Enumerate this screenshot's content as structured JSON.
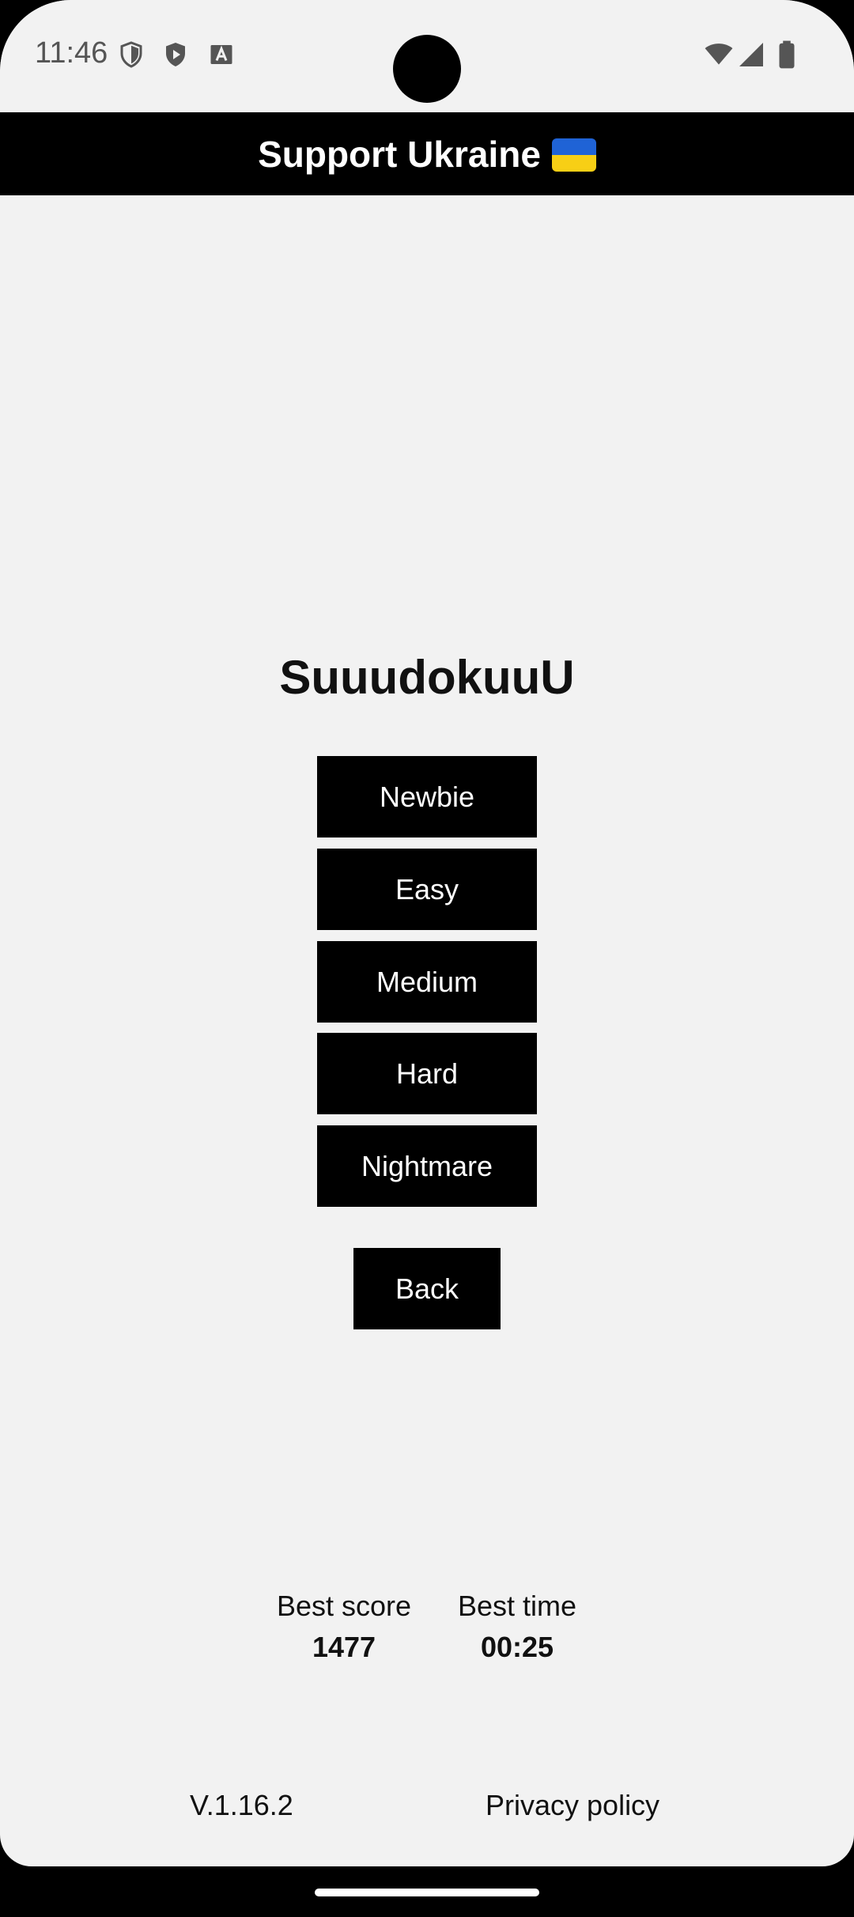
{
  "status_bar": {
    "time": "11:46",
    "icons": [
      "shield-icon",
      "play-store-icon",
      "font-a-icon",
      "wifi-icon",
      "signal-icon",
      "battery-icon"
    ]
  },
  "banner": {
    "text": "Support Ukraine",
    "flag_colors": [
      "#1f63d6",
      "#f7cf15"
    ]
  },
  "title": "SuuudokuuU",
  "difficulties": [
    "Newbie",
    "Easy",
    "Medium",
    "Hard",
    "Nightmare"
  ],
  "back_label": "Back",
  "stats": {
    "best_score_label": "Best score",
    "best_score_value": "1477",
    "best_time_label": "Best time",
    "best_time_value": "00:25"
  },
  "footer": {
    "version": "V.1.16.2",
    "privacy": "Privacy policy"
  }
}
